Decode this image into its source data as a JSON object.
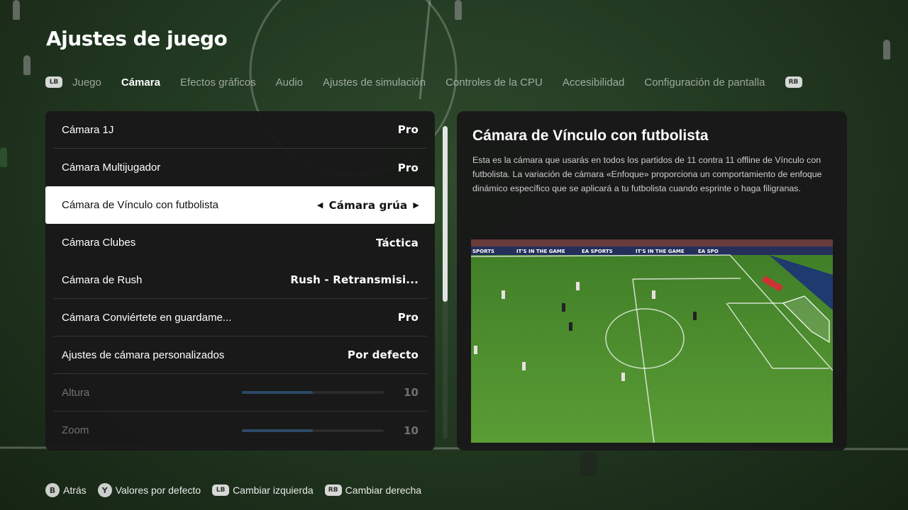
{
  "page": {
    "title": "Ajustes de juego"
  },
  "tabs": {
    "lb": "LB",
    "rb": "RB",
    "items": [
      {
        "label": "Juego",
        "active": false
      },
      {
        "label": "Cámara",
        "active": true
      },
      {
        "label": "Efectos gráficos",
        "active": false
      },
      {
        "label": "Audio",
        "active": false
      },
      {
        "label": "Ajustes de simulación",
        "active": false
      },
      {
        "label": "Controles de la CPU",
        "active": false
      },
      {
        "label": "Accesibilidad",
        "active": false
      },
      {
        "label": "Configuración de pantalla",
        "active": false
      }
    ]
  },
  "settings": {
    "rows": [
      {
        "label": "Cámara 1J",
        "value": "Pro"
      },
      {
        "label": "Cámara Multijugador",
        "value": "Pro"
      },
      {
        "label": "Cámara de Vínculo con futbolista",
        "value": "Cámara grúa",
        "selected": true
      },
      {
        "label": "Cámara Clubes",
        "value": "Táctica"
      },
      {
        "label": "Cámara de Rush",
        "value": "Rush - Retransmisi..."
      },
      {
        "label": "Cámara Conviértete en guardame...",
        "value": "Pro"
      },
      {
        "label": "Ajustes de cámara personalizados",
        "value": "Por defecto"
      }
    ],
    "sliders": [
      {
        "label": "Altura",
        "value": "10",
        "fill": 0.5
      },
      {
        "label": "Zoom",
        "value": "10",
        "fill": 0.5
      }
    ]
  },
  "info": {
    "title": "Cámara de Vínculo con futbolista",
    "description": "Esta es la cámara que usarás en todos los partidos de 11 contra 11 offline de Vínculo con futbolista. La variación de cámara «Enfoque» proporciona un comportamiento de enfoque dinámico específico que se aplicará a tu futbolista cuando esprinte o haga filigranas.",
    "preview_banner": [
      "SPORTS",
      "IT'S IN THE GAME",
      "EA SPORTS",
      "IT'S IN THE GAME",
      "EA SPO"
    ]
  },
  "hints": [
    {
      "button": "B",
      "label": "Atrás"
    },
    {
      "button": "Y",
      "label": "Valores por defecto"
    },
    {
      "button": "LB",
      "label": "Cambiar izquierda"
    },
    {
      "button": "RB",
      "label": "Cambiar derecha"
    }
  ],
  "colors": {
    "panel": "#181818",
    "selected_row": "#ffffff",
    "slider_fill": "#2c4a66",
    "pitch": "#4f8e2f"
  }
}
